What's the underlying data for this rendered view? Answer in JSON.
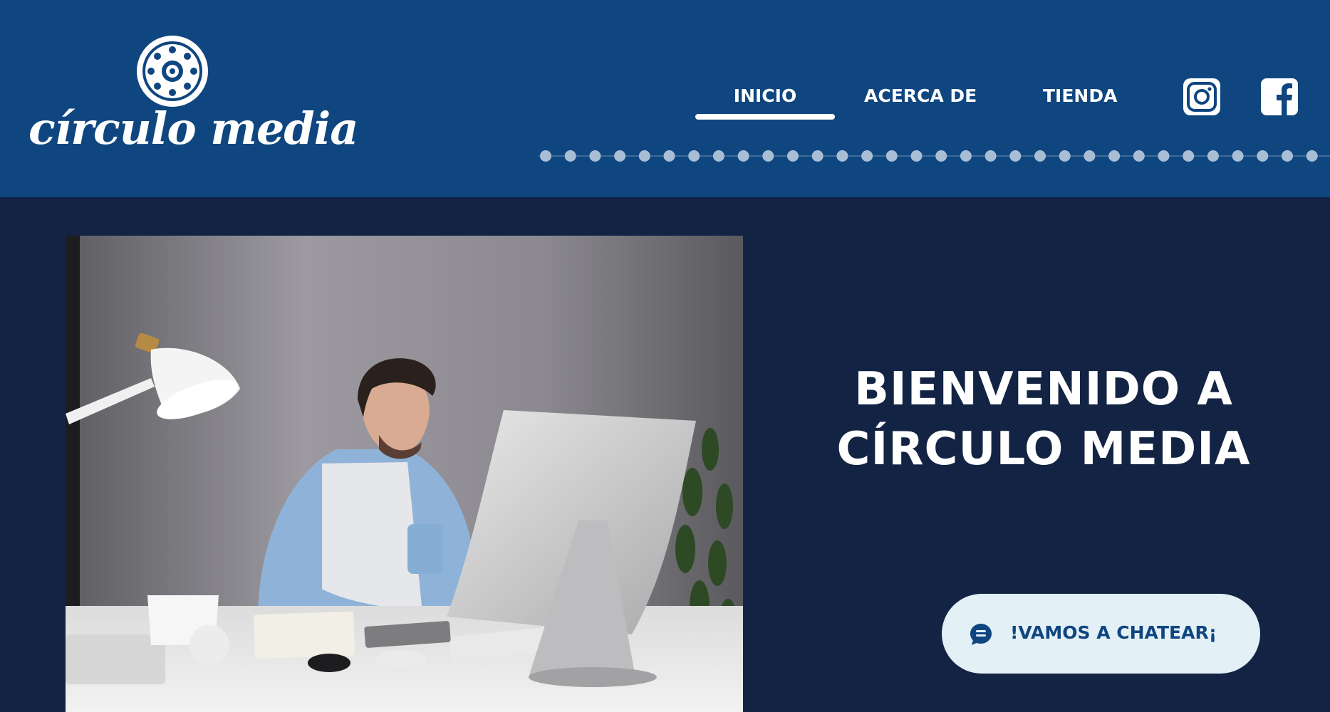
{
  "header": {
    "brand": "círculo media",
    "nav": [
      {
        "label": "INICIO",
        "active": true
      },
      {
        "label": "ACERCA DE",
        "active": false
      },
      {
        "label": "TIENDA",
        "active": false
      }
    ],
    "social_icons": [
      "instagram-icon",
      "facebook-icon"
    ]
  },
  "hero": {
    "title_line1": "BIENVENIDO A",
    "title_line2": "CÍRCULO MEDIA",
    "photo": "man-working-at-desktop-computer"
  },
  "chat": {
    "label": "!VAMOS A CHATEAR¡",
    "icon": "chat-bubble-icon"
  },
  "colors": {
    "header_bg": "#0f4680",
    "page_bg": "#132343",
    "chat_button_bg": "#e3f0f5",
    "chat_text": "#0f4680",
    "text_light": "#ffffff",
    "dots": "#a9bed4"
  }
}
